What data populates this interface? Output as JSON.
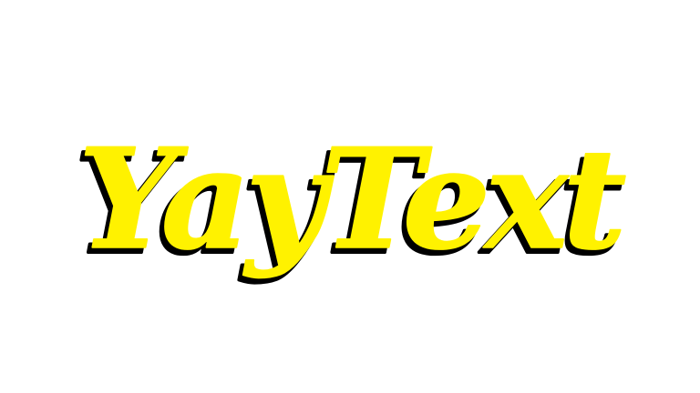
{
  "logo": {
    "text": "YayText",
    "fill_color": "#FFF200",
    "shadow_color": "#000000",
    "background_color": "#FFFFFF"
  }
}
